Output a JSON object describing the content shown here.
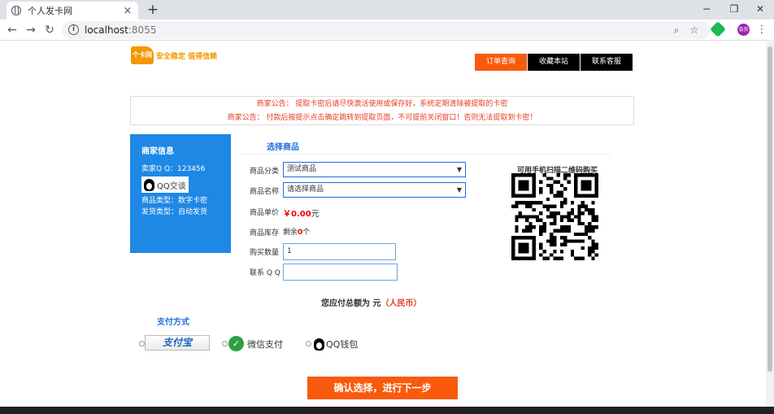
{
  "browser": {
    "tab_title": "个人发卡网",
    "tab_close": "×",
    "new_tab": "+",
    "url_host": "localhost",
    "url_port": ":8055",
    "min": "−",
    "max": "❐",
    "close": "✕",
    "profile_label": "会员"
  },
  "header": {
    "logo_text": "个卡网",
    "slogan": "安全稳定 值得信赖",
    "nav": [
      "订单查询",
      "收藏本站",
      "联系客服"
    ]
  },
  "notice": {
    "lines": [
      "商家公告：  提取卡密后请尽快激活使用或保存好，系统定期清除被提取的卡密",
      "商家公告：  付款后按提示点击确定跳转到提取页面，不可提前关闭窗口！否则无法提取到卡密！"
    ]
  },
  "merchant": {
    "title": "商家信息",
    "qq_label": "卖家Q Q：",
    "qq_value": "123456",
    "qq_talk": "QQ交谈",
    "type_label": "商品类型：",
    "type_value": "数字卡密",
    "ship_label": "发货类型：",
    "ship_value": "自动发货"
  },
  "form": {
    "section_title": "选择商品",
    "category_label": "商品分类",
    "category_value": "测试商品",
    "name_label": "商品名称",
    "name_value": "请选择商品",
    "price_label": "商品单价",
    "price_symbol": "￥",
    "price_value": "0.00",
    "price_unit": "元",
    "stock_label": "商品库存",
    "stock_prefix": "剩余",
    "stock_value": "0",
    "stock_unit": "个",
    "qty_label": "购买数量",
    "qty_value": "1",
    "contact_label": "联系 Q Q",
    "contact_value": ""
  },
  "qr": {
    "title": "可用手机扫描二维码购买"
  },
  "total": {
    "prefix": "您应付总额为",
    "unit": "元",
    "currency": "（人民币）"
  },
  "payment": {
    "title": "支付方式",
    "alipay": "支付宝",
    "wechat": "微信支付",
    "qqwallet": "QQ钱包"
  },
  "submit_label": "确认选择，进行下一步",
  "colors": {
    "accent_orange": "#f95a0c",
    "merchant_blue": "#1e88e5",
    "notice_red": "#e53c20"
  }
}
